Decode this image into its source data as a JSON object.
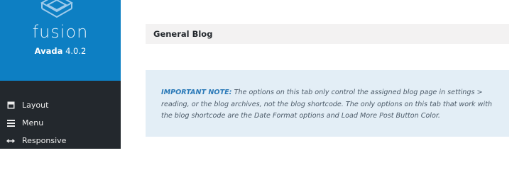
{
  "brand": {
    "name": "fusion",
    "product": "Avada",
    "version": "4.0.2"
  },
  "menu": {
    "items": [
      {
        "label": "Layout",
        "icon": "layout-icon"
      },
      {
        "label": "Menu",
        "icon": "hamburger-menu-icon"
      },
      {
        "label": "Responsive",
        "icon": "resize-arrows-icon"
      }
    ]
  },
  "section": {
    "title": "General Blog"
  },
  "note": {
    "label": "IMPORTANT NOTE:",
    "text": "The options on this tab only control the assigned blog page in settings > reading, or the blog archives, not the blog shortcode. The only options on this tab that work with the blog shortcode are the Date Format options and Load More Post Button Color."
  },
  "colors": {
    "brand_blue": "#0d7fc3",
    "sidebar_dark": "#23282d",
    "note_background": "#e3eef6",
    "note_label": "#2b7ab8"
  }
}
